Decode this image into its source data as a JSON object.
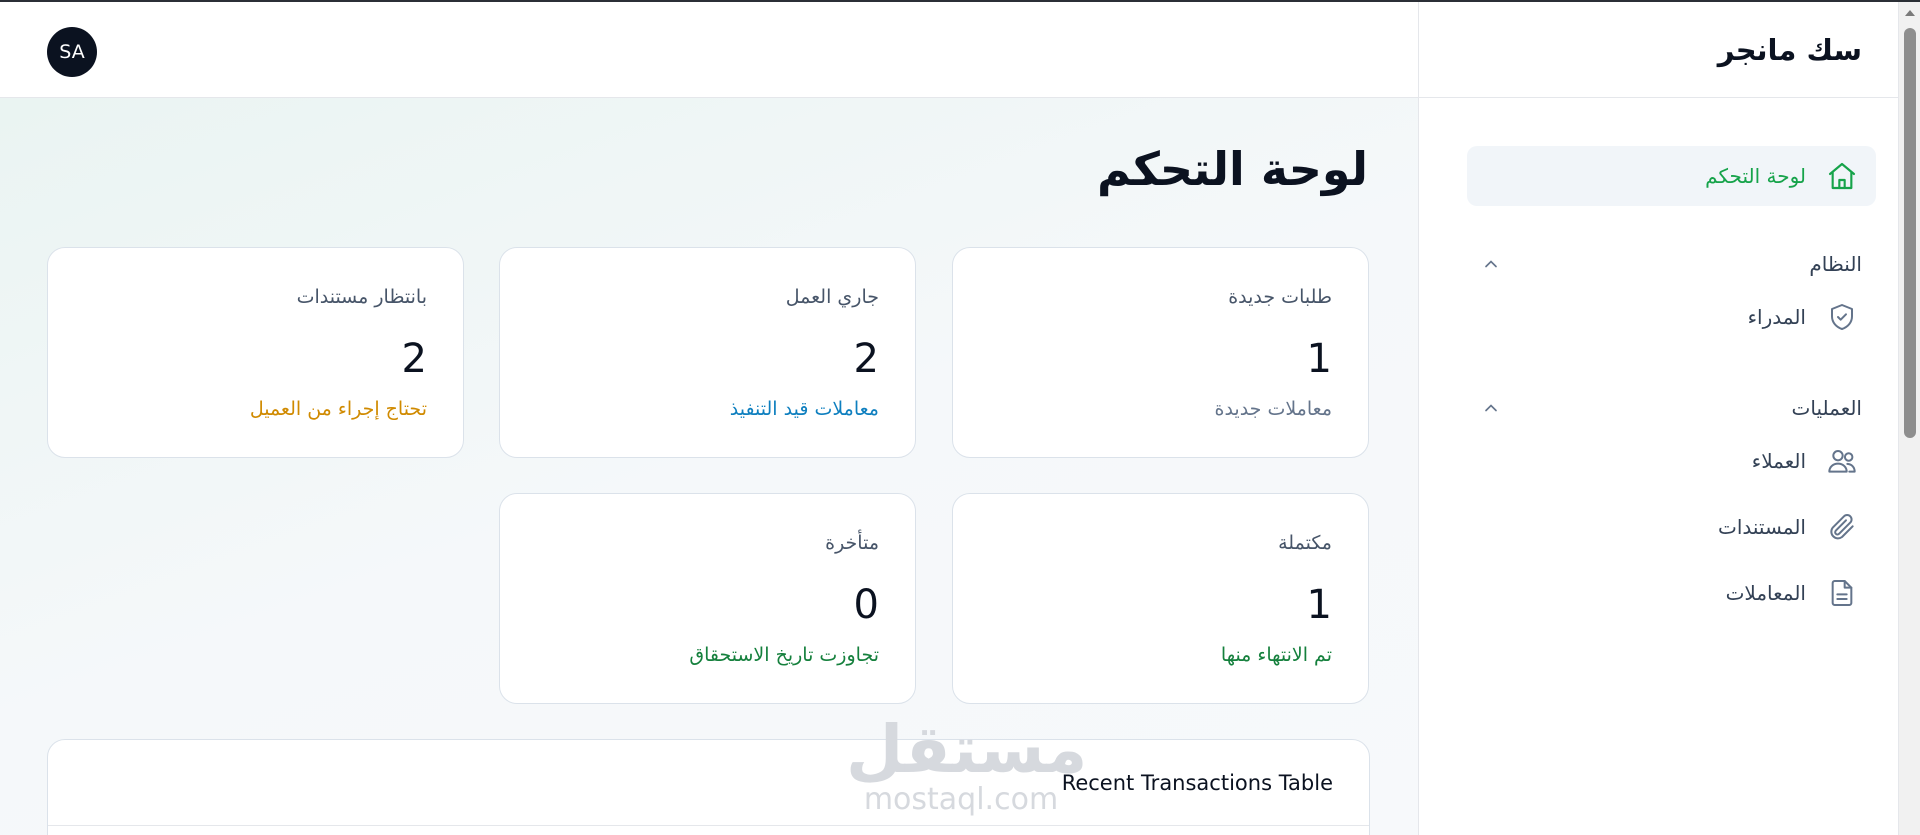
{
  "app": {
    "brand": "سك مانجر"
  },
  "header": {
    "avatar_initials": "SA"
  },
  "sidebar": {
    "dashboard_label": "لوحة التحكم",
    "sections": [
      {
        "title": "النظام",
        "items": [
          {
            "label": "المدراء",
            "icon": "shield-check-icon"
          }
        ]
      },
      {
        "title": "العمليات",
        "items": [
          {
            "label": "العملاء",
            "icon": "users-icon"
          },
          {
            "label": "المستندات",
            "icon": "paperclip-icon"
          },
          {
            "label": "المعاملات",
            "icon": "file-text-icon"
          }
        ]
      }
    ]
  },
  "main": {
    "title": "لوحة التحكم",
    "cards": [
      {
        "label": "طلبات جديدة",
        "value": "1",
        "note": "معاملات جديدة",
        "note_color": "#64748b"
      },
      {
        "label": "جاري العمل",
        "value": "2",
        "note": "معاملات قيد التنفيذ",
        "note_color": "#0e7fbf"
      },
      {
        "label": "بانتظار مستندات",
        "value": "2",
        "note": "تحتاج إجراء من العميل",
        "note_color": "#d08a00"
      },
      {
        "label": "مكتملة",
        "value": "1",
        "note": "تم الانتهاء منها",
        "note_color": "#15803d"
      },
      {
        "label": "متأخرة",
        "value": "0",
        "note": "تجاوزت تاريخ الاستحقاق",
        "note_color": "#15803d"
      }
    ],
    "table_title": "Recent Transactions Table"
  },
  "watermark": {
    "arabic": "مستقل",
    "latin": "mostaql.com"
  },
  "colors": {
    "accent": "#16a34a",
    "dark": "#0b1220"
  }
}
